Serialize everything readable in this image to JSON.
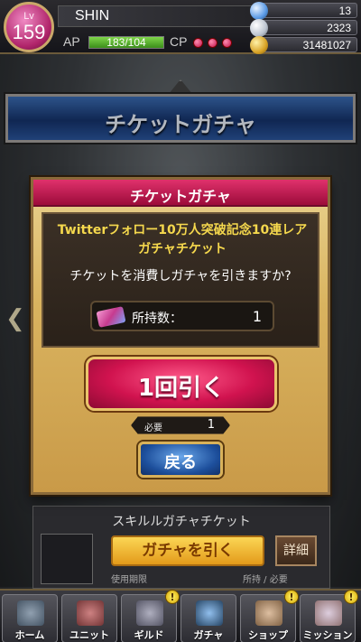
{
  "player": {
    "level_label": "Lv",
    "level": "159",
    "name": "SHIN",
    "ap_label": "AP",
    "ap_value": "183/104",
    "ap_fill": 1.0,
    "cp_label": "CP",
    "cp_points": 3
  },
  "currency": [
    {
      "icon": "crystal-icon",
      "value": "13"
    },
    {
      "icon": "orb-icon",
      "value": "2323"
    },
    {
      "icon": "gold-coin-icon",
      "value": "31481027"
    }
  ],
  "banner": {
    "title": "チケットガチャ"
  },
  "dialog": {
    "title": "チケットガチャ",
    "ticket_name": "Twitterフォロー10万人突破記念10連レアガチャチケット",
    "question": "チケットを消費しガチャを引きますか?",
    "owned_label": "所持数：",
    "owned_value": "1",
    "pull_button": "1回引く",
    "required_label": "必要",
    "required_value": "1",
    "back_button": "戻る"
  },
  "background_list": {
    "title": "スキルルガチャチケット",
    "pull_button": "ガチャを引く",
    "detail_button": "詳細",
    "expiry_label": "使用期限",
    "owned_required_label": "所持 / 必要"
  },
  "nav": [
    {
      "label": "ホーム",
      "icon": "home-icon",
      "badge": ""
    },
    {
      "label": "ユニット",
      "icon": "unit-icon",
      "badge": ""
    },
    {
      "label": "ギルド",
      "icon": "guild-icon",
      "badge": "!"
    },
    {
      "label": "ガチャ",
      "icon": "gacha-icon",
      "badge": ""
    },
    {
      "label": "ショップ",
      "icon": "shop-icon",
      "badge": "!"
    },
    {
      "label": "ミッション",
      "icon": "mission-icon",
      "badge": "!"
    }
  ],
  "colors": {
    "dialog_header": "#c4164f",
    "pull_button": "#d1134f",
    "back_button": "#1d4f9c",
    "ticket_text": "#f5d84d"
  }
}
